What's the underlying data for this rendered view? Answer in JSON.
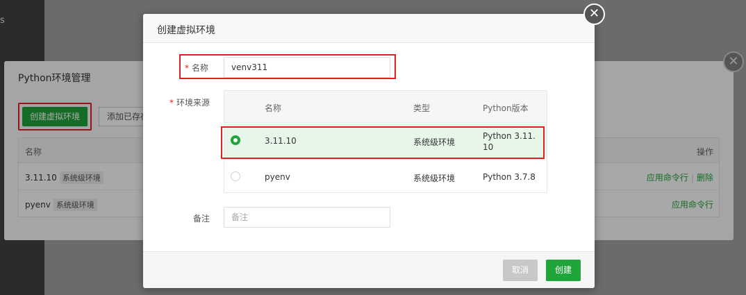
{
  "background": {
    "sidebar_fragment": "s",
    "panel": {
      "title": "Python环境管理",
      "create_button": "创建虚拟环境",
      "add_button": "添加已存在",
      "table": {
        "headers": {
          "name": "名称",
          "actions": "操作"
        },
        "rows": [
          {
            "name": "3.11.10",
            "tag": "系统级环境",
            "actions": [
              "应用命令行",
              "删除"
            ]
          },
          {
            "name": "pyenv",
            "tag": "系统级环境",
            "actions": [
              "应用命令行"
            ]
          }
        ]
      },
      "close_symbol": "✕"
    }
  },
  "dialog": {
    "title": "创建虚拟环境",
    "close_symbol": "✕",
    "form": {
      "required_mark": "*",
      "name": {
        "label": "名称",
        "value": "venv311"
      },
      "source": {
        "label": "环境来源",
        "headers": {
          "name": "名称",
          "type": "类型",
          "version": "Python版本"
        },
        "rows": [
          {
            "name": "3.11.10",
            "type": "系统级环境",
            "version": "Python 3.11.10",
            "selected": true
          },
          {
            "name": "pyenv",
            "type": "系统级环境",
            "version": "Python 3.7.8",
            "selected": false
          }
        ]
      },
      "remark": {
        "label": "备注",
        "value": "",
        "placeholder": "备注"
      }
    },
    "footer": {
      "cancel_label": "取消",
      "confirm_label": "创建"
    }
  },
  "colors": {
    "primary": "#20a53a",
    "highlight_border": "#e02020",
    "disabled": "#c8c8c8"
  }
}
